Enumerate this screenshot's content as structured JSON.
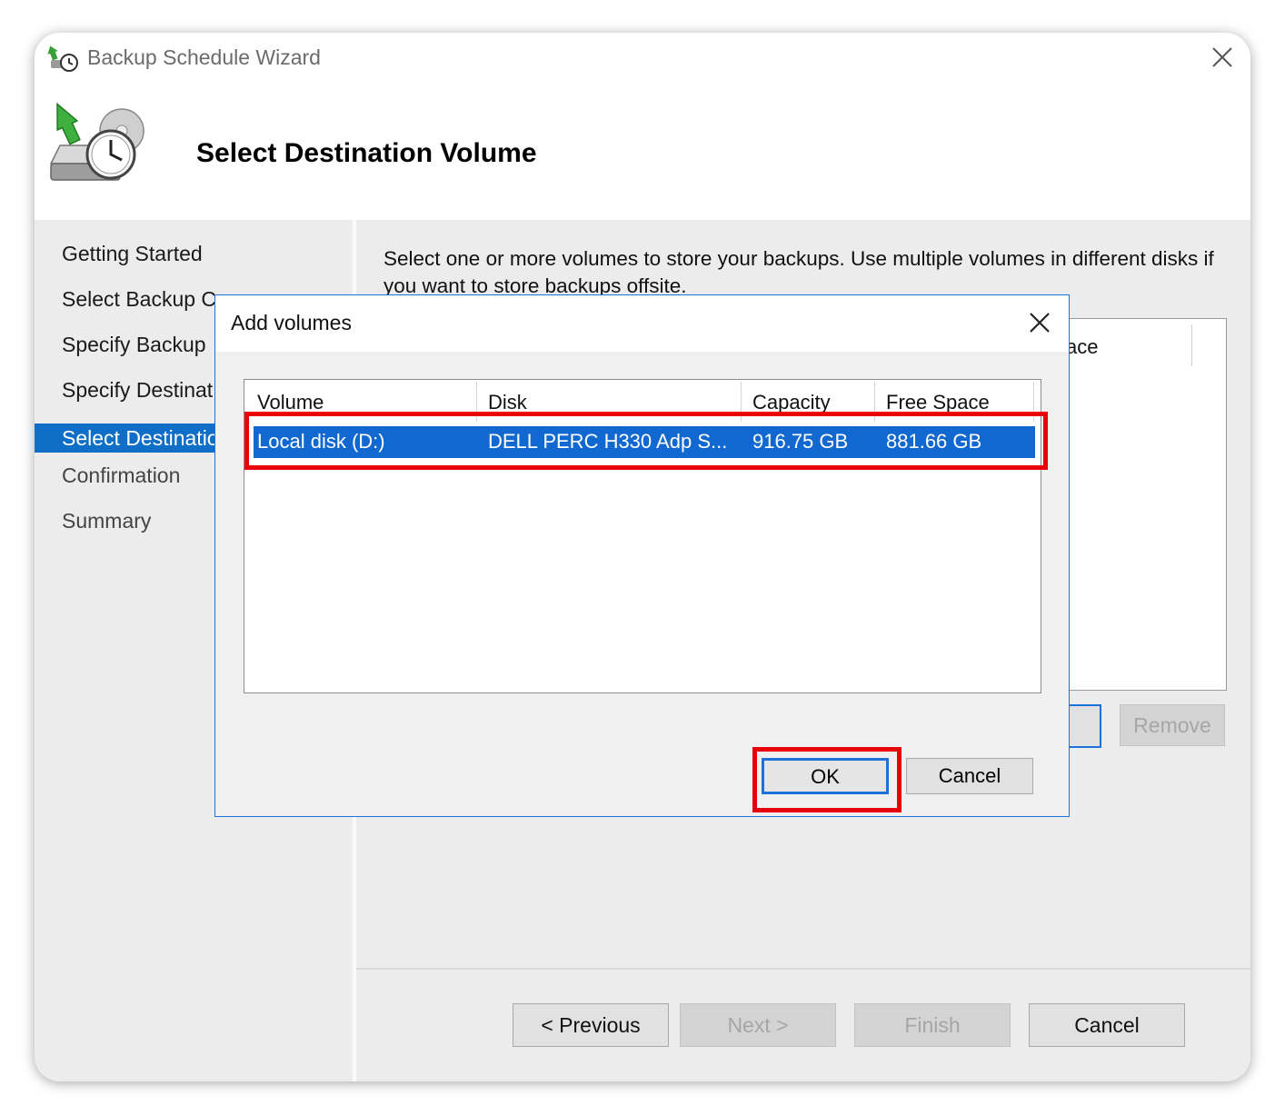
{
  "window": {
    "title": "Backup Schedule Wizard"
  },
  "header": {
    "page_title": "Select Destination Volume"
  },
  "nav": {
    "items": [
      {
        "label": "Getting Started"
      },
      {
        "label": "Select Backup C"
      },
      {
        "label": "Specify Backup "
      },
      {
        "label": "Specify Destinat"
      },
      {
        "label": "Select Destinatio",
        "active": true
      },
      {
        "label": "Confirmation"
      },
      {
        "label": "Summary"
      }
    ]
  },
  "main": {
    "instructions": "Select one or more volumes to store your backups. Use multiple volumes in different disks if you want to store backups offsite.",
    "list_header_fragment": "ace",
    "remove_label": "Remove"
  },
  "footer": {
    "previous_label": "< Previous",
    "next_label": "Next >",
    "finish_label": "Finish",
    "cancel_label": "Cancel"
  },
  "dialog": {
    "title": "Add volumes",
    "columns": [
      "Volume",
      "Disk",
      "Capacity",
      "Free Space"
    ],
    "rows": [
      {
        "volume": "Local disk (D:)",
        "disk": "DELL PERC H330 Adp S...",
        "capacity": "916.75 GB",
        "free_space": "881.66 GB",
        "selected": true
      }
    ],
    "ok_label": "OK",
    "cancel_label": "Cancel"
  },
  "colors": {
    "accent": "#0f6fc6",
    "highlight_box": "#e8000b",
    "selection": "#1168d0"
  }
}
